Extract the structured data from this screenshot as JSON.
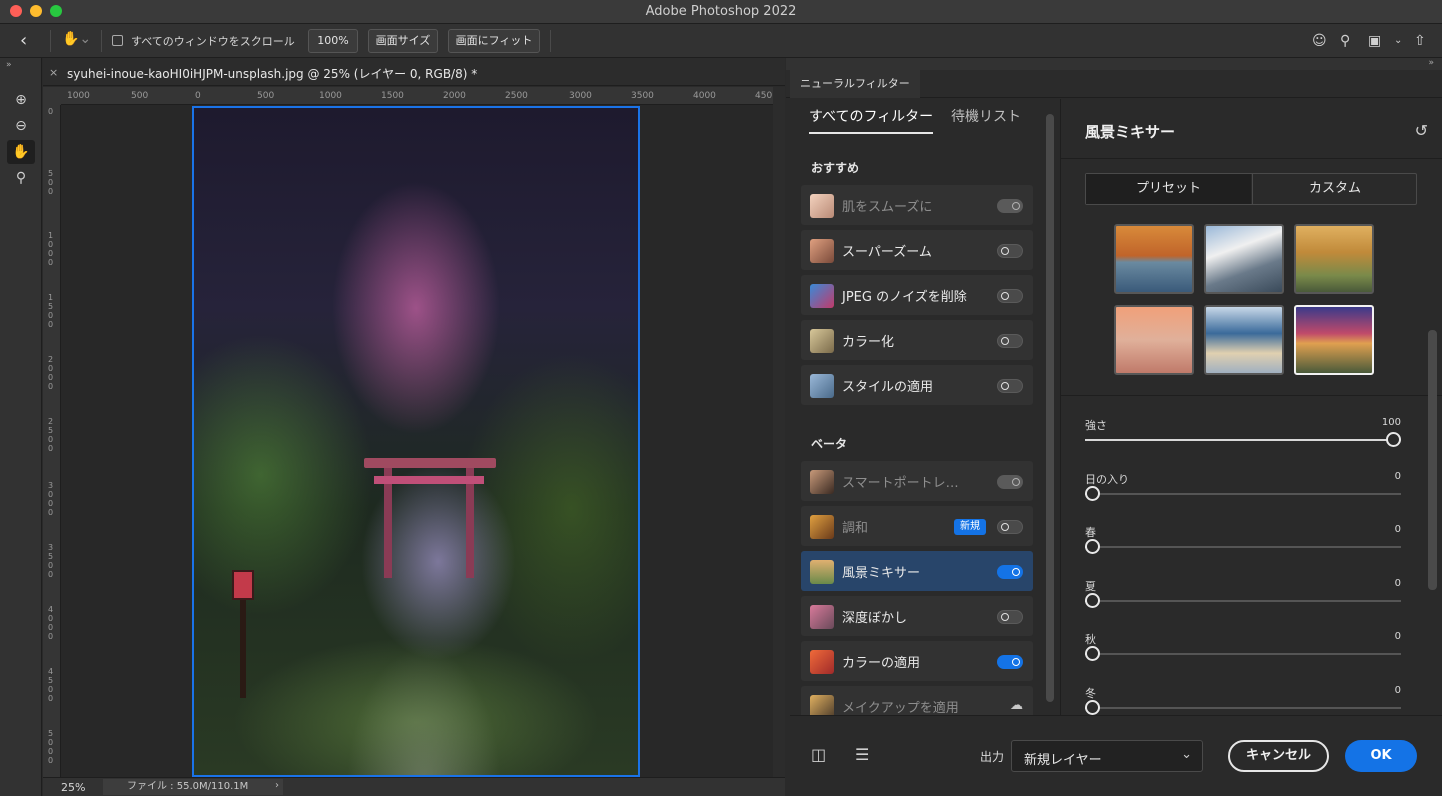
{
  "window": {
    "title": "Adobe Photoshop 2022"
  },
  "options_bar": {
    "scroll_all_label": "すべてのウィンドウをスクロール",
    "zoom_100": "100%",
    "fit_screen_size": "画面サイズ",
    "fit_screen": "画面にフィット"
  },
  "document": {
    "tab_title": "syuhei-inoue-kaoHI0iHJPM-unsplash.jpg @ 25% (レイヤー 0, RGB/8) *",
    "ruler_h": [
      "1000",
      "500",
      "0",
      "500",
      "1000",
      "1500",
      "2000",
      "2500",
      "3000",
      "3500",
      "4000",
      "450"
    ],
    "ruler_v": [
      "0",
      "500",
      "1000",
      "1500",
      "2000",
      "2500",
      "3000",
      "3500",
      "4000",
      "4500",
      "5000"
    ],
    "zoom": "25%",
    "file_info": "ファイル : 55.0M/110.1M"
  },
  "neural_filters": {
    "panel_tab": "ニューラルフィルター",
    "tabs": {
      "all": "すべてのフィルター",
      "waitlist": "待機リスト"
    },
    "section_featured": "おすすめ",
    "section_beta": "ベータ",
    "featured": [
      {
        "label": "肌をスムーズに",
        "state": "dim-on"
      },
      {
        "label": "スーパーズーム",
        "state": "off"
      },
      {
        "label": "JPEG のノイズを削除",
        "state": "off"
      },
      {
        "label": "カラー化",
        "state": "off"
      },
      {
        "label": "スタイルの適用",
        "state": "off"
      }
    ],
    "beta": [
      {
        "label": "スマートポートレ…",
        "state": "dim-on"
      },
      {
        "label": "調和",
        "state": "off",
        "badge": "新規"
      },
      {
        "label": "風景ミキサー",
        "state": "on"
      },
      {
        "label": "深度ぼかし",
        "state": "off"
      },
      {
        "label": "カラーの適用",
        "state": "on"
      },
      {
        "label": "メイクアップを適用",
        "state": "cloud"
      }
    ],
    "settings": {
      "title": "風景ミキサー",
      "segment": {
        "preset": "プリセット",
        "custom": "カスタム"
      },
      "sliders": [
        {
          "label": "強さ",
          "value": "100",
          "fraction": 1.0
        },
        {
          "label": "日の入り",
          "value": "0",
          "fraction": 0
        },
        {
          "label": "春",
          "value": "0",
          "fraction": 0
        },
        {
          "label": "夏",
          "value": "0",
          "fraction": 0
        },
        {
          "label": "秋",
          "value": "0",
          "fraction": 0
        },
        {
          "label": "冬",
          "value": "0",
          "fraction": 0
        }
      ]
    },
    "output_label": "出力",
    "output_value": "新規レイヤー",
    "cancel_label": "キャンセル",
    "ok_label": "OK"
  },
  "colors": {
    "accent": "#1473e6",
    "selection": "#28456a"
  }
}
